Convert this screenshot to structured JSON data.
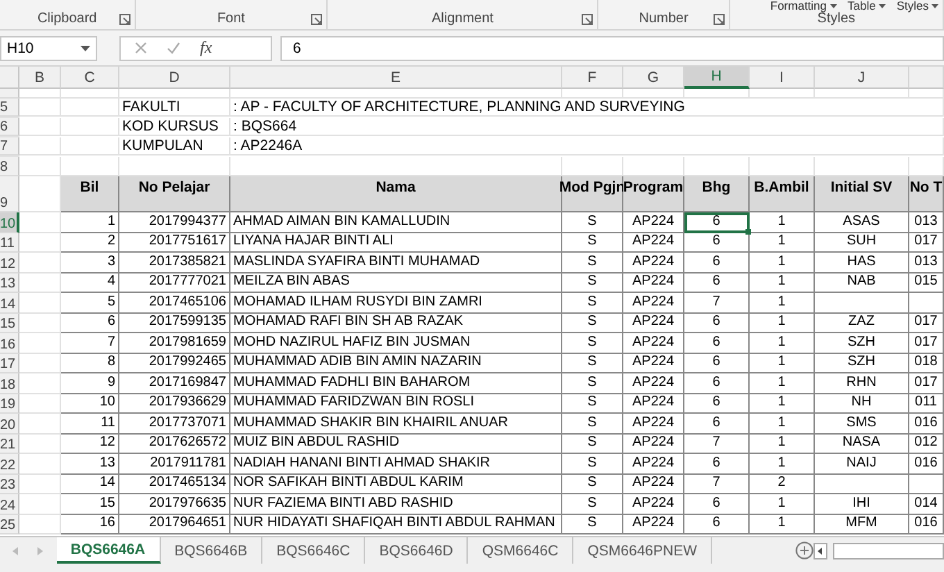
{
  "ribbon": {
    "partial_buttons": [
      "Formatting",
      "Table",
      "Styles"
    ],
    "groups": [
      {
        "label": "Clipboard"
      },
      {
        "label": "Font"
      },
      {
        "label": "Alignment"
      },
      {
        "label": "Number"
      },
      {
        "label": "Styles"
      }
    ]
  },
  "formula_bar": {
    "name_box": "H10",
    "function_label": "fx",
    "value": "6"
  },
  "columns": [
    {
      "label": "B",
      "selected": false
    },
    {
      "label": "C",
      "selected": false
    },
    {
      "label": "D",
      "selected": false
    },
    {
      "label": "E",
      "selected": false
    },
    {
      "label": "F",
      "selected": false
    },
    {
      "label": "G",
      "selected": false
    },
    {
      "label": "H",
      "selected": true
    },
    {
      "label": "I",
      "selected": false
    },
    {
      "label": "J",
      "selected": false
    }
  ],
  "rows": [
    {
      "kind": "info",
      "number": "5",
      "selected": false,
      "label": "FAKULTI",
      "value": ": AP - FACULTY OF ARCHITECTURE, PLANNING AND SURVEYING"
    },
    {
      "kind": "info",
      "number": "6",
      "selected": false,
      "label": "KOD KURSUS",
      "value": ": BQS664"
    },
    {
      "kind": "info",
      "number": "7",
      "selected": false,
      "label": "KUMPULAN",
      "value": ": AP2246A"
    },
    {
      "kind": "blank",
      "number": "8",
      "selected": false
    },
    {
      "kind": "header",
      "number": "9",
      "selected": false,
      "cells": [
        "Bil",
        "No Pelajar",
        "Nama",
        "Mod Pgjn",
        "Program",
        "Bhg",
        "B.Ambil",
        "Initial SV",
        "No T"
      ]
    },
    {
      "kind": "data",
      "number": "10",
      "selected": true,
      "cells": [
        "1",
        "2017994377",
        "AHMAD AIMAN BIN KAMALLUDIN",
        "S",
        "AP224",
        "6",
        "1",
        "ASAS",
        "013"
      ]
    },
    {
      "kind": "data",
      "number": "11",
      "selected": false,
      "cells": [
        "2",
        "2017751617",
        "LIYANA HAJAR BINTI ALI",
        "S",
        "AP224",
        "6",
        "1",
        "SUH",
        "017"
      ]
    },
    {
      "kind": "data",
      "number": "12",
      "selected": false,
      "cells": [
        "3",
        "2017385821",
        "MASLINDA SYAFIRA BINTI MUHAMAD",
        "S",
        "AP224",
        "6",
        "1",
        "HAS",
        "013"
      ]
    },
    {
      "kind": "data",
      "number": "13",
      "selected": false,
      "cells": [
        "4",
        "2017777021",
        "MEILZA BIN ABAS",
        "S",
        "AP224",
        "6",
        "1",
        "NAB",
        "015"
      ]
    },
    {
      "kind": "data",
      "number": "14",
      "selected": false,
      "cells": [
        "5",
        "2017465106",
        "MOHAMAD ILHAM RUSYDI BIN ZAMRI",
        "S",
        "AP224",
        "7",
        "1",
        "",
        ""
      ]
    },
    {
      "kind": "data",
      "number": "15",
      "selected": false,
      "cells": [
        "6",
        "2017599135",
        "MOHAMAD RAFI BIN SH AB RAZAK",
        "S",
        "AP224",
        "6",
        "1",
        "ZAZ",
        "017"
      ]
    },
    {
      "kind": "data",
      "number": "16",
      "selected": false,
      "cells": [
        "7",
        "2017981659",
        "MOHD NAZIRUL HAFIZ BIN JUSMAN",
        "S",
        "AP224",
        "6",
        "1",
        "SZH",
        "017"
      ]
    },
    {
      "kind": "data",
      "number": "17",
      "selected": false,
      "cells": [
        "8",
        "2017992465",
        "MUHAMMAD ADIB BIN AMIN NAZARIN",
        "S",
        "AP224",
        "6",
        "1",
        "SZH",
        "018"
      ]
    },
    {
      "kind": "data",
      "number": "18",
      "selected": false,
      "cells": [
        "9",
        "2017169847",
        "MUHAMMAD FADHLI BIN BAHAROM",
        "S",
        "AP224",
        "6",
        "1",
        "RHN",
        "017"
      ]
    },
    {
      "kind": "data",
      "number": "19",
      "selected": false,
      "cells": [
        "10",
        "2017936629",
        "MUHAMMAD FARIDZWAN BIN ROSLI",
        "S",
        "AP224",
        "6",
        "1",
        "NH",
        "011"
      ]
    },
    {
      "kind": "data",
      "number": "20",
      "selected": false,
      "cells": [
        "11",
        "2017737071",
        "MUHAMMAD SHAKIR BIN KHAIRIL ANUAR",
        "S",
        "AP224",
        "6",
        "1",
        "SMS",
        "016"
      ]
    },
    {
      "kind": "data",
      "number": "21",
      "selected": false,
      "cells": [
        "12",
        "2017626572",
        "MUIZ BIN ABDUL RASHID",
        "S",
        "AP224",
        "7",
        "1",
        "NASA",
        "012"
      ]
    },
    {
      "kind": "data",
      "number": "22",
      "selected": false,
      "cells": [
        "13",
        "2017911781",
        "NADIAH HANANI BINTI AHMAD SHAKIR",
        "S",
        "AP224",
        "6",
        "1",
        "NAIJ",
        "016"
      ]
    },
    {
      "kind": "data",
      "number": "23",
      "selected": false,
      "cells": [
        "14",
        "2017465134",
        "NOR SAFIKAH BINTI ABDUL KARIM",
        "S",
        "AP224",
        "7",
        "2",
        "",
        ""
      ]
    },
    {
      "kind": "data",
      "number": "24",
      "selected": false,
      "cells": [
        "15",
        "2017976635",
        "NUR FAZIEMA BINTI ABD RASHID",
        "S",
        "AP224",
        "6",
        "1",
        "IHI",
        "014"
      ]
    },
    {
      "kind": "data",
      "number": "25",
      "selected": false,
      "cells": [
        "16",
        "2017964651",
        "NUR HIDAYATI SHAFIQAH BINTI ABDUL RAHMAN",
        "S",
        "AP224",
        "6",
        "1",
        "MFM",
        "016"
      ]
    }
  ],
  "sheet_tabs": [
    {
      "label": "BQS6646A",
      "selected": true
    },
    {
      "label": "BQS6646B",
      "selected": false
    },
    {
      "label": "BQS6646C",
      "selected": false
    },
    {
      "label": "BQS6646D",
      "selected": false
    },
    {
      "label": "QSM6646C",
      "selected": false
    },
    {
      "label": "QSM6646PNEW",
      "selected": false
    }
  ]
}
